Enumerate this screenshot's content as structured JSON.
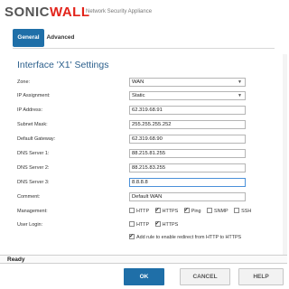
{
  "header": {
    "logo_prefix": "SONIC",
    "logo_suffix": "WALL",
    "subtitle": "Network Security Appliance"
  },
  "tabs": [
    {
      "label": "General",
      "active": true
    },
    {
      "label": "Advanced",
      "active": false
    }
  ],
  "panel": {
    "title": "Interface 'X1' Settings"
  },
  "form": {
    "zone_label": "Zone:",
    "zone_value": "WAN",
    "ip_assignment_label": "IP Assignment:",
    "ip_assignment_value": "Static",
    "ip_address_label": "IP Address:",
    "ip_address_value": "62.319.68.91",
    "subnet_label": "Subnet Mask:",
    "subnet_value": "255.255.255.252",
    "gateway_label": "Default Gateway:",
    "gateway_value": "62.319.68.90",
    "dns1_label": "DNS Server 1:",
    "dns1_value": "88.215.81.255",
    "dns2_label": "DNS Server 2:",
    "dns2_value": "88.215.83.255",
    "dns3_label": "DNS Server 3:",
    "dns3_value": "8.8.8.8",
    "comment_label": "Comment:",
    "comment_value": "Default WAN",
    "management_label": "Management:",
    "management_options": [
      {
        "label": "HTTP",
        "checked": false
      },
      {
        "label": "HTTPS",
        "checked": true
      },
      {
        "label": "Ping",
        "checked": true
      },
      {
        "label": "SNMP",
        "checked": false
      },
      {
        "label": "SSH",
        "checked": false
      }
    ],
    "user_login_label": "User Login:",
    "user_login_options": [
      {
        "label": "HTTP",
        "checked": false
      },
      {
        "label": "HTTPS",
        "checked": true
      }
    ],
    "redirect_label": "Add rule to enable redirect from HTTP to HTTPS",
    "redirect_checked": true
  },
  "status": {
    "text": "Ready"
  },
  "buttons": {
    "ok": "OK",
    "cancel": "CANCEL",
    "help": "HELP"
  },
  "colors": {
    "brand_blue": "#1f6fa8",
    "logo_red": "#e2231a",
    "title_blue": "#2b5f8c"
  }
}
